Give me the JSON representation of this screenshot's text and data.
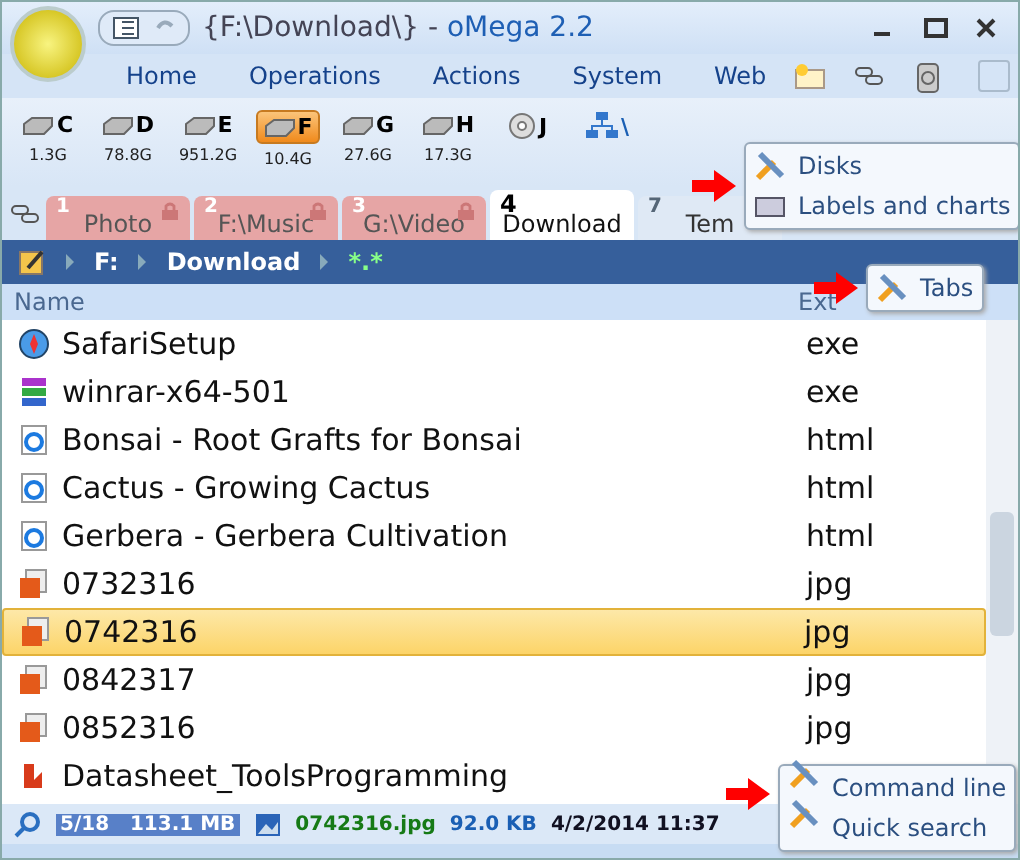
{
  "window": {
    "title": "{F:\\Download\\} - ",
    "app_name": "oMega 2.2"
  },
  "menu": [
    {
      "label": "Home"
    },
    {
      "label": "Operations"
    },
    {
      "label": "Actions"
    },
    {
      "label": "System"
    },
    {
      "label": "Web"
    }
  ],
  "drives": [
    {
      "kind": "disk",
      "letter": "C",
      "size": "1.3G",
      "selected": false
    },
    {
      "kind": "disk",
      "letter": "D",
      "size": "78.8G",
      "selected": false
    },
    {
      "kind": "disk",
      "letter": "E",
      "size": "951.2G",
      "selected": false
    },
    {
      "kind": "disk",
      "letter": "F",
      "size": "10.4G",
      "selected": true
    },
    {
      "kind": "disk",
      "letter": "G",
      "size": "27.6G",
      "selected": false
    },
    {
      "kind": "disk",
      "letter": "H",
      "size": "17.3G",
      "selected": false
    },
    {
      "kind": "cd",
      "letter": "J",
      "selected": false
    },
    {
      "kind": "network",
      "letter": "\\",
      "selected": false
    }
  ],
  "tabs": [
    {
      "number": "1",
      "label": "Photo",
      "locked": true,
      "selected": false
    },
    {
      "number": "2",
      "label": "F:\\Music",
      "locked": true,
      "selected": false
    },
    {
      "number": "3",
      "label": "G:\\Video",
      "locked": true,
      "selected": false
    },
    {
      "number": "4",
      "label": "Download",
      "locked": false,
      "selected": true
    },
    {
      "number": "7",
      "label": "Tem",
      "locked": false,
      "selected": false
    }
  ],
  "path": [
    {
      "label": "F:"
    },
    {
      "label": "Download"
    },
    {
      "label": "*.*"
    }
  ],
  "columns": [
    "Name",
    "Ext"
  ],
  "files": [
    {
      "kind": "setup",
      "name": "SafariSetup",
      "ext": "exe",
      "selected": false
    },
    {
      "kind": "archive",
      "name": "winrar-x64-501",
      "ext": "exe",
      "selected": false
    },
    {
      "kind": "html",
      "name": "Bonsai - Root Grafts for Bonsai",
      "ext": "html",
      "selected": false
    },
    {
      "kind": "html",
      "name": "Cactus - Growing Cactus",
      "ext": "html",
      "selected": false
    },
    {
      "kind": "html",
      "name": "Gerbera - Gerbera Cultivation",
      "ext": "html",
      "selected": false
    },
    {
      "kind": "image",
      "name": "0732316",
      "ext": "jpg",
      "selected": false
    },
    {
      "kind": "image",
      "name": "0742316",
      "ext": "jpg",
      "selected": true
    },
    {
      "kind": "image",
      "name": "0842317",
      "ext": "jpg",
      "selected": false
    },
    {
      "kind": "image",
      "name": "0852316",
      "ext": "jpg",
      "selected": false
    },
    {
      "kind": "pdf",
      "name": "Datasheet_ToolsProgramming",
      "selected": false
    }
  ],
  "status": {
    "count": "5/18",
    "total": "113.1 MB",
    "file": "0742316.jpg",
    "size": "92.0 KB",
    "date": "4/2/2014 11:37"
  },
  "popups": {
    "drives": [
      "Disks",
      "Labels and charts"
    ],
    "path": [
      "Tabs"
    ],
    "status": [
      "Command line",
      "Quick search"
    ]
  }
}
